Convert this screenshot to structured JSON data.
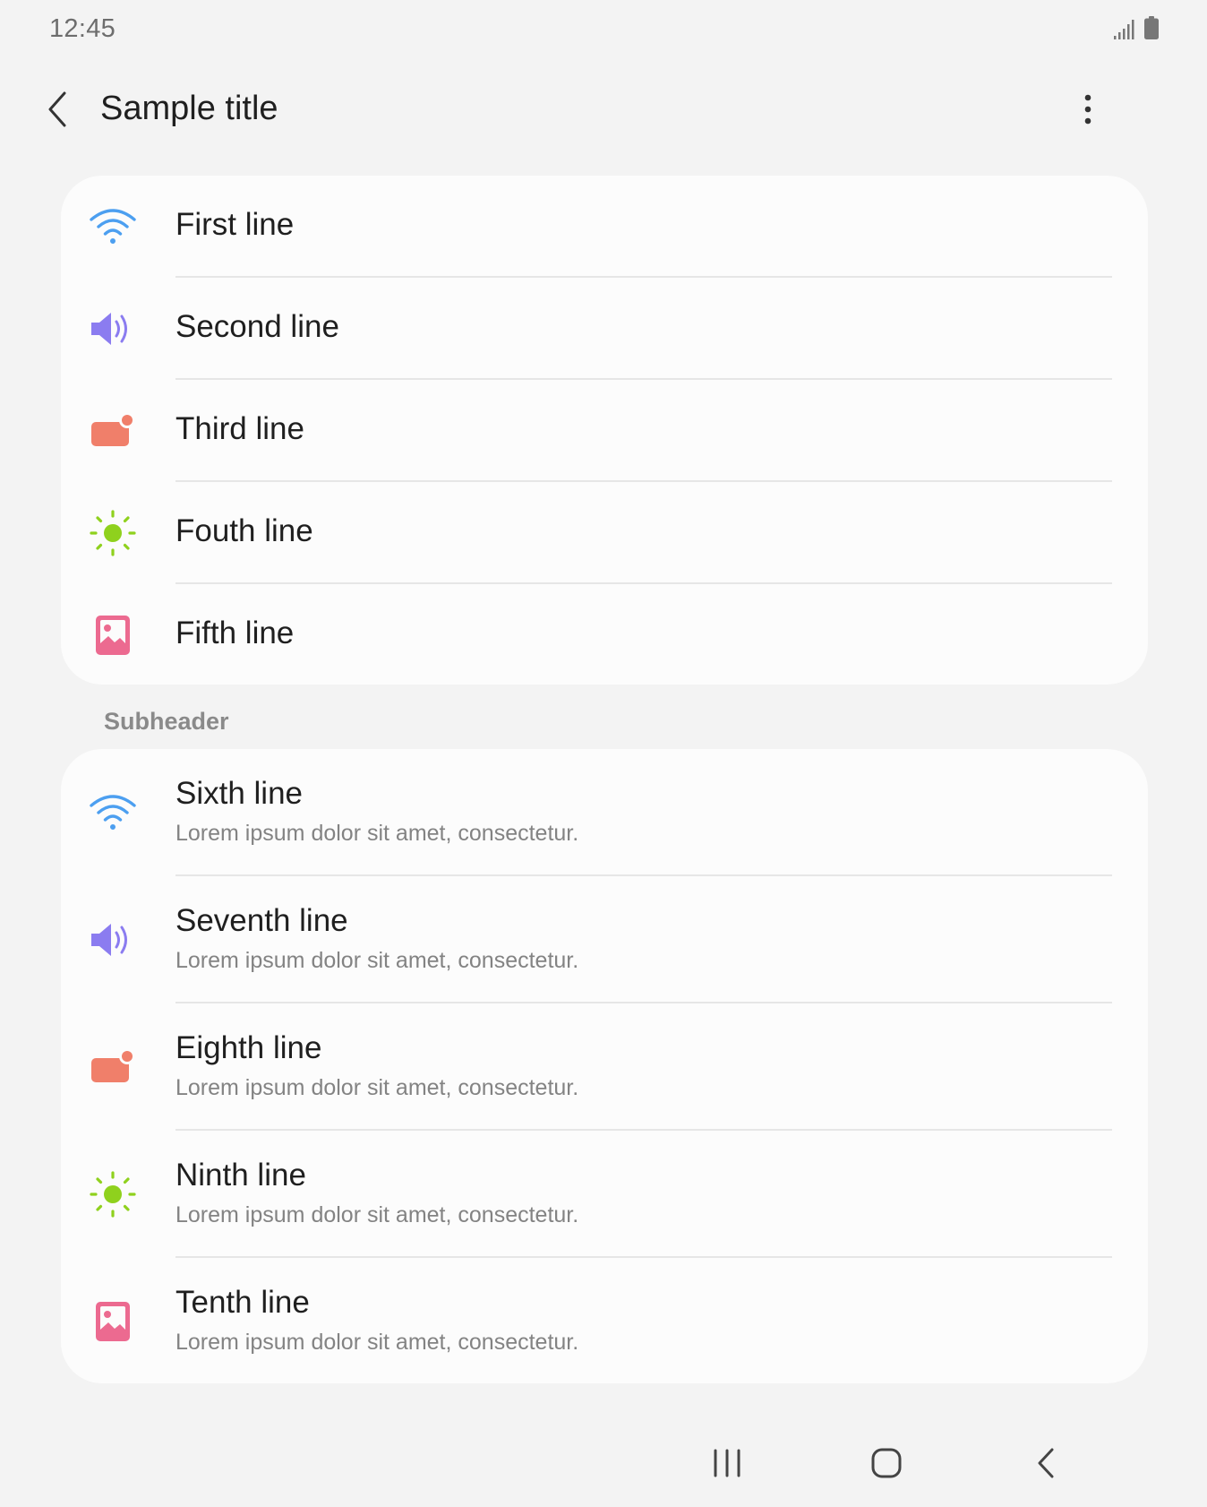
{
  "status_bar": {
    "time": "12:45",
    "icons": [
      "signal-icon",
      "battery-icon"
    ]
  },
  "app_bar": {
    "title": "Sample title",
    "back_icon": "chevron-left-icon",
    "more_icon": "more-vertical-icon"
  },
  "list_group_1": {
    "items": [
      {
        "title": "First line",
        "icon": "wifi-icon"
      },
      {
        "title": "Second line",
        "icon": "volume-icon"
      },
      {
        "title": "Third line",
        "icon": "notification-badge-icon"
      },
      {
        "title": "Fouth line",
        "icon": "brightness-icon"
      },
      {
        "title": "Fifth line",
        "icon": "image-icon"
      }
    ]
  },
  "subheader": "Subheader",
  "list_group_2": {
    "items": [
      {
        "title": "Sixth line",
        "subtitle": "Lorem ipsum dolor sit amet, consectetur.",
        "icon": "wifi-icon"
      },
      {
        "title": "Seventh line",
        "subtitle": "Lorem ipsum dolor sit amet, consectetur.",
        "icon": "volume-icon"
      },
      {
        "title": "Eighth line",
        "subtitle": "Lorem ipsum dolor sit amet, consectetur.",
        "icon": "notification-badge-icon"
      },
      {
        "title": "Ninth line",
        "subtitle": "Lorem ipsum dolor sit amet, consectetur.",
        "icon": "brightness-icon"
      },
      {
        "title": "Tenth line",
        "subtitle": "Lorem ipsum dolor sit amet, consectetur.",
        "icon": "image-icon"
      }
    ]
  },
  "nav_bar": {
    "buttons": [
      "recents-icon",
      "home-icon",
      "back-icon"
    ]
  },
  "colors": {
    "background": "#f3f3f3",
    "card": "#fcfcfc",
    "wifi": "#4c9ff0",
    "volume": "#8b7cf0",
    "notification": "#f07f6a",
    "brightness": "#8fd11d",
    "image": "#ec6a90",
    "subtitle_text": "#838383"
  }
}
